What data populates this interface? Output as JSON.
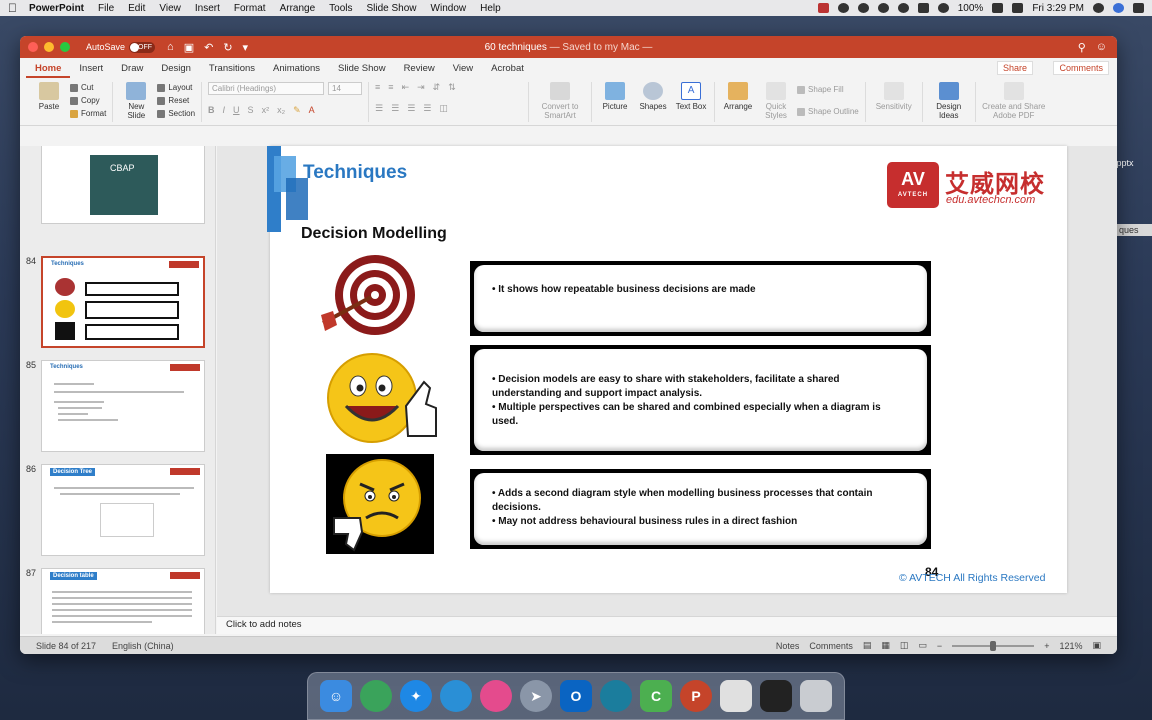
{
  "menubar": {
    "app": "PowerPoint",
    "items": [
      "File",
      "Edit",
      "View",
      "Insert",
      "Format",
      "Arrange",
      "Tools",
      "Slide Show",
      "Window",
      "Help"
    ],
    "battery": "100%",
    "time": "Fri 3:29 PM"
  },
  "desktop": {
    "file1": ".pptx",
    "file2": "ques"
  },
  "window": {
    "autosave_label": "AutoSave",
    "autosave_state": "OFF",
    "doc_name": "60 techniques",
    "doc_status": "— Saved to my Mac —"
  },
  "tabs": [
    "Home",
    "Insert",
    "Draw",
    "Design",
    "Transitions",
    "Animations",
    "Slide Show",
    "Review",
    "View",
    "Acrobat"
  ],
  "share_label": "Share",
  "comments_label": "Comments",
  "ribbon": {
    "paste": "Paste",
    "cut": "Cut",
    "copy": "Copy",
    "format": "Format",
    "new_slide": "New Slide",
    "layout": "Layout",
    "reset": "Reset",
    "section": "Section",
    "font_name": "Calibri (Headings)",
    "font_size": "14",
    "convert": "Convert to SmartArt",
    "picture": "Picture",
    "shapes": "Shapes",
    "textbox": "Text Box",
    "arrange": "Arrange",
    "quick_styles": "Quick Styles",
    "shape_fill": "Shape Fill",
    "shape_outline": "Shape Outline",
    "sensitivity": "Sensitivity",
    "design_ideas": "Design Ideas",
    "create_share": "Create and Share Adobe PDF"
  },
  "thumbnails": [
    {
      "num": "",
      "title": "CBAP"
    },
    {
      "num": "84",
      "title": "Techniques"
    },
    {
      "num": "85",
      "title": "Techniques"
    },
    {
      "num": "86",
      "title": "Decision Tree"
    },
    {
      "num": "87",
      "title": "Decision table"
    }
  ],
  "slide": {
    "title": "Techniques",
    "logo_text": "AV",
    "logo_sub": "AVTECH",
    "logo_cn": "艾威网校",
    "logo_url": "edu.avtechcn.com",
    "heading": "Decision Modelling",
    "box1": [
      "• It shows how repeatable business decisions are made"
    ],
    "box2": [
      "• Decision models are easy to share with stakeholders, facilitate a shared understanding and support impact analysis.",
      "• Multiple perspectives can be shared and combined especially when a diagram is used."
    ],
    "box3": [
      "• Adds a second diagram style when modelling business processes that contain decisions.",
      "• May not address behavioural business rules in a direct fashion"
    ],
    "page_num": "84",
    "copyright": "© AVTECH All Rights Reserved"
  },
  "notes_placeholder": "Click to add notes",
  "status": {
    "slide_info": "Slide 84 of 217",
    "language": "English (China)",
    "notes": "Notes",
    "comments": "Comments",
    "zoom": "121%"
  }
}
